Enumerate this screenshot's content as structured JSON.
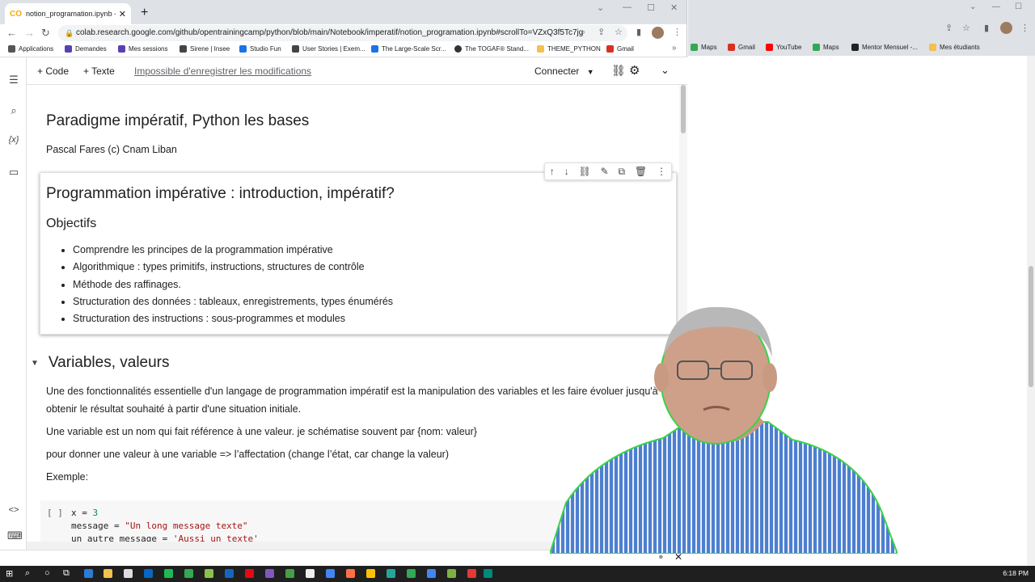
{
  "browser": {
    "tab_title": "notion_programation.ipynb - Co",
    "url": "colab.research.google.com/github/opentrainingcamp/python/blob/main/Notebook/imperatif/notion_programation.ipynb#scrollTo=VZxQ3f5Tc7jg",
    "bookmarks": [
      "Applications",
      "Demandes",
      "Mes sessions",
      "Sirene | Insee",
      "Studio Fun",
      "User Stories | Exem...",
      "The Large-Scale Scr...",
      "The TOGAF® Stand...",
      "THEME_PYTHON",
      "Gmail"
    ],
    "right_bookmarks": [
      "Maps",
      "Gmail",
      "YouTube",
      "Maps",
      "Mentor Mensuel -...",
      "Mes étudiants"
    ]
  },
  "colab": {
    "add_code": "+ Code",
    "add_text": "+ Texte",
    "not_saved": "Impossible d'enregistrer les modifications",
    "connect": "Connecter",
    "title": "Paradigme impératif, Python les bases",
    "author": "Pascal Fares (c) Cnam Liban",
    "cell_heading": "Programmation impérative : introduction, impératif?",
    "objectives_heading": "Objectifs",
    "objectives": [
      "Comprendre les principes de la programmation impérative",
      "Algorithmique : types primitifs, instructions, structures de contrôle",
      "Méthode des raffinages.",
      "Structuration des données : tableaux, enregistrements, types énumérés",
      "Structuration des instructions : sous-programmes et modules"
    ],
    "section_heading": "Variables, valeurs",
    "paragraphs": [
      "Une des fonctionnalités essentielle d'un langage de programmation impératif est la manipulation des variables et les faire évoluer jusqu'à obtenir le résultat souhaité à partir d'une situation initiale.",
      "Une variable est un nom qui fait référence à une valeur. je schématise souvent par {nom: valeur}",
      "pour donner une valeur à une variable => l’affectation (change l’état, car change la valeur)",
      "Exemple:"
    ],
    "code_bracket": "[ ]",
    "code": [
      {
        "name": "x",
        "op": " = ",
        "value": "3",
        "kind": "num"
      },
      {
        "name": "message",
        "op": " = ",
        "value": "\"Un long message texte\"",
        "kind": "str"
      },
      {
        "name": "un_autre_message",
        "op": " = ",
        "value": "'Aussi un texte'",
        "kind": "str"
      }
    ]
  },
  "taskbar": {
    "clock": "6:18 PM"
  }
}
